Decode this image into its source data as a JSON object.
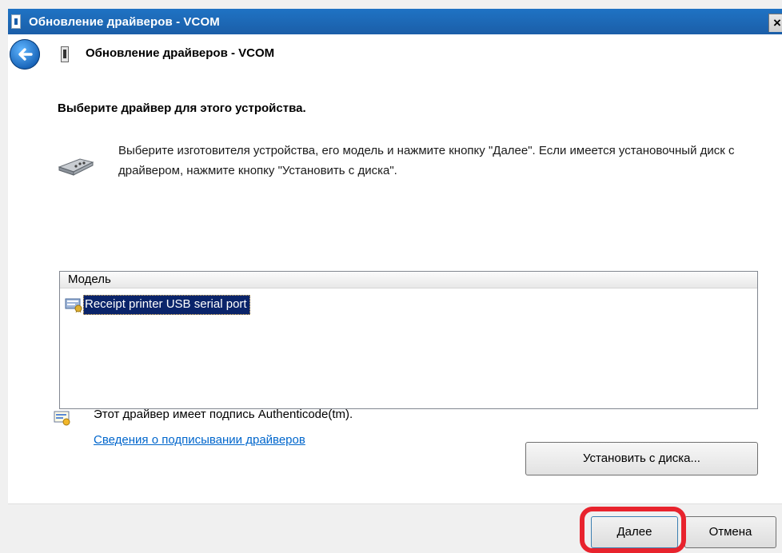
{
  "window": {
    "title": "Обновление драйверов - VCOM",
    "close_label": "×"
  },
  "header": {
    "title": "Обновление драйверов - VCOM"
  },
  "main": {
    "heading": "Выберите драйвер для этого устройства.",
    "instruction": "Выберите изготовителя устройства, его модель и нажмите кнопку \"Далее\". Если имеется установочный диск с  драйвером, нажмите кнопку \"Установить с диска\".",
    "list": {
      "column_header": "Модель",
      "items": [
        "Receipt printer USB serial port"
      ]
    },
    "signature_text": "Этот драйвер имеет подпись Authenticode(tm).",
    "signature_link": "Сведения о подписывании драйверов",
    "have_disk_label": "Установить с диска..."
  },
  "footer": {
    "next_label": "Далее",
    "cancel_label": "Отмена"
  },
  "colors": {
    "titlebar": "#1b5ea8",
    "selection": "#0a246a",
    "link": "#0066cc",
    "highlight": "#e8232d"
  }
}
